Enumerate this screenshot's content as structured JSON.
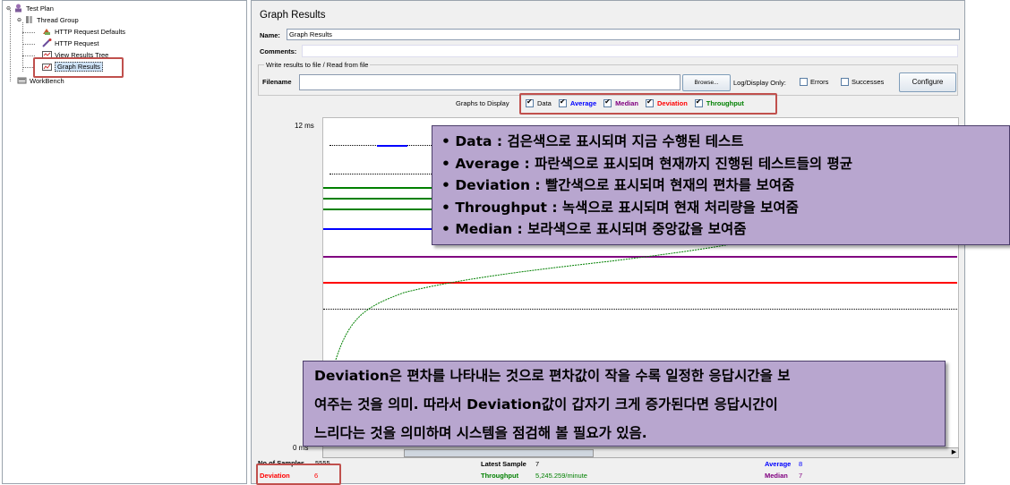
{
  "tree": {
    "items": [
      {
        "label": "Test Plan",
        "icon": "test-plan-icon"
      },
      {
        "label": "Thread Group",
        "icon": "thread-group-icon"
      },
      {
        "label": "HTTP Request Defaults",
        "icon": "config-element-icon"
      },
      {
        "label": "HTTP Request",
        "icon": "sampler-icon"
      },
      {
        "label": "View Results Tree",
        "icon": "listener-icon"
      },
      {
        "label": "Graph Results",
        "icon": "graph-listener-icon"
      },
      {
        "label": "WorkBench",
        "icon": "workbench-icon"
      }
    ]
  },
  "panel": {
    "title": "Graph Results",
    "name_label": "Name:",
    "name_value": "Graph Results",
    "comments_label": "Comments:",
    "file_section_title": "Write results to file / Read from file",
    "filename_label": "Filename",
    "filename_value": "",
    "browse_button": "Browse...",
    "log_display_label": "Log/Display Only:",
    "errors_label": "Errors",
    "successes_label": "Successes",
    "configure_button": "Configure"
  },
  "graphs_to_display": {
    "label": "Graphs to Display",
    "options": [
      {
        "label": "Data",
        "checked": true,
        "color": "#000000"
      },
      {
        "label": "Average",
        "checked": true,
        "color": "#0000ff"
      },
      {
        "label": "Median",
        "checked": true,
        "color": "#800080"
      },
      {
        "label": "Deviation",
        "checked": true,
        "color": "#ff0000"
      },
      {
        "label": "Throughput",
        "checked": true,
        "color": "#008000"
      }
    ]
  },
  "graph": {
    "y_max_label": "12 ms",
    "y_min_label": "0 ms"
  },
  "status": {
    "samples_label": "No of Samples",
    "samples_value": "5555",
    "latest_label": "Latest Sample",
    "latest_value": "7",
    "average_label": "Average",
    "average_value": "8",
    "deviation_label": "Deviation",
    "deviation_value": "6",
    "throughput_label": "Throughput",
    "throughput_value": "5,245.259/minute",
    "median_label": "Median",
    "median_value": "7"
  },
  "callout_legend": {
    "lines": [
      {
        "term": "Data",
        "desc": " : 검은색으로 표시되며 지금 수행된 테스트"
      },
      {
        "term": "Average",
        "desc": " : 파란색으로 표시되며 현재까지 진행된 테스트들의 평균"
      },
      {
        "term": "Deviation",
        "desc": " : 빨간색으로 표시되며 현재의 편차를 보여줌"
      },
      {
        "term": "Throughput",
        "desc": " : 녹색으로 표시되며 현재 처리량을 보여줌"
      },
      {
        "term": "Median",
        "desc": " : 보라색으로 표시되며 중앙값을 보여줌"
      }
    ]
  },
  "callout_note": {
    "lines": [
      "Deviation은 편차를 나타내는 것으로 편차값이 작을 수록 일정한 응답시간을 보",
      "여주는 것을 의미.  따라서 Deviation값이 갑자기 크게 증가된다면 응답시간이",
      "느리다는 것을 의미하며 시스템을 점검해 볼 필요가 있음."
    ]
  }
}
